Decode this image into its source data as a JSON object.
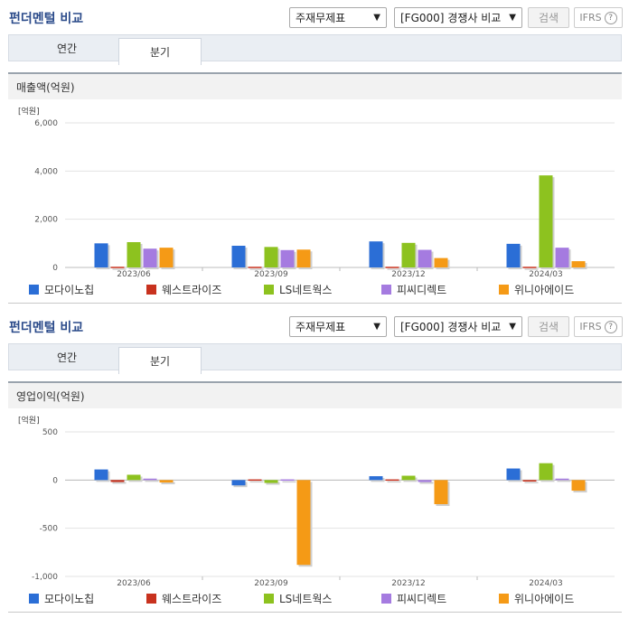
{
  "panels": [
    {
      "title": "펀더멘털 비교",
      "select_report": "주재무제표",
      "select_compare": "[FG000] 경쟁사 비교",
      "search_label": "검색",
      "ifrs_label": "IFRS",
      "help_glyph": "?",
      "tabs": [
        {
          "label": "연간",
          "active": false
        },
        {
          "label": "분기",
          "active": true
        }
      ],
      "section_label": "매출액(억원)"
    },
    {
      "title": "펀더멘털 비교",
      "select_report": "주재무제표",
      "select_compare": "[FG000] 경쟁사 비교",
      "search_label": "검색",
      "ifrs_label": "IFRS",
      "help_glyph": "?",
      "tabs": [
        {
          "label": "연간",
          "active": false
        },
        {
          "label": "분기",
          "active": true
        }
      ],
      "section_label": "영업이익(억원)"
    }
  ],
  "icons": {
    "dropdown": "chevron-down-icon",
    "help": "help-circle-icon"
  },
  "chart_data": [
    {
      "type": "bar",
      "title": "매출액(억원)",
      "unit_label": "[억원]",
      "categories": [
        "2023/06",
        "2023/09",
        "2023/12",
        "2024/03"
      ],
      "ylim": [
        0,
        6000
      ],
      "yticks": [
        0,
        2000,
        4000,
        6000
      ],
      "ytick_labels": [
        "0",
        "2,000",
        "4,000",
        "6,000"
      ],
      "grid": true,
      "legend_position": "bottom",
      "series": [
        {
          "name": "모다이노칩",
          "color": "#2b6ed6",
          "values": [
            1000,
            900,
            1080,
            980
          ]
        },
        {
          "name": "웨스트라이즈",
          "color": "#c8321e",
          "values": [
            0,
            0,
            0,
            0
          ]
        },
        {
          "name": "LS네트웍스",
          "color": "#8dc21f",
          "values": [
            1050,
            850,
            1020,
            3820
          ]
        },
        {
          "name": "피씨디렉트",
          "color": "#a57be0",
          "values": [
            780,
            720,
            730,
            820
          ]
        },
        {
          "name": "위니아에이드",
          "color": "#f59a16",
          "values": [
            820,
            740,
            390,
            260
          ]
        }
      ]
    },
    {
      "type": "bar",
      "title": "영업이익(억원)",
      "unit_label": "[억원]",
      "categories": [
        "2023/06",
        "2023/09",
        "2023/12",
        "2024/03"
      ],
      "ylim": [
        -1000,
        500
      ],
      "yticks": [
        -1000,
        -500,
        0,
        500
      ],
      "ytick_labels": [
        "-1,000",
        "-500",
        "0",
        "500"
      ],
      "grid": true,
      "legend_position": "bottom",
      "series": [
        {
          "name": "모다이노칩",
          "color": "#2b6ed6",
          "values": [
            110,
            -55,
            40,
            120
          ]
        },
        {
          "name": "웨스트라이즈",
          "color": "#c8321e",
          "values": [
            -20,
            0,
            0,
            -15
          ]
        },
        {
          "name": "LS네트웍스",
          "color": "#8dc21f",
          "values": [
            55,
            -30,
            45,
            175
          ]
        },
        {
          "name": "피씨디렉트",
          "color": "#a57be0",
          "values": [
            15,
            0,
            -20,
            15
          ]
        },
        {
          "name": "위니아에이드",
          "color": "#f59a16",
          "values": [
            -25,
            -880,
            -250,
            -110
          ]
        }
      ]
    }
  ]
}
